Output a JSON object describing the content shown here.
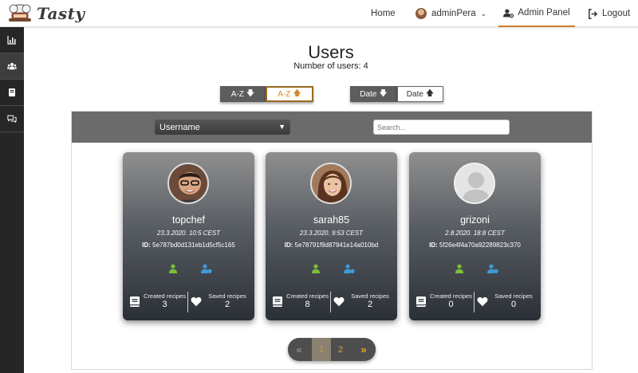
{
  "brand": {
    "name": "Tasty"
  },
  "nav": {
    "home": "Home",
    "user": "adminPera",
    "admin_panel": "Admin Panel",
    "logout": "Logout"
  },
  "sidebar": {
    "items": [
      {
        "icon": "bar-chart-icon"
      },
      {
        "icon": "users-icon",
        "active": true
      },
      {
        "icon": "book-icon"
      },
      {
        "icon": "comments-icon"
      }
    ]
  },
  "page": {
    "title": "Users",
    "count_text": "Number of users: 4"
  },
  "sort": {
    "az_down": "A-Z",
    "az_up": "A-Z",
    "date_down": "Date",
    "date_up": "Date",
    "active_color": "#d08a2a"
  },
  "filter": {
    "select_value": "Username",
    "search_placeholder": "Search..."
  },
  "users": [
    {
      "username": "topchef",
      "date": "23.3.2020. 10:5 CEST",
      "id_label": "ID:",
      "id": "5e787bd0d131eb1d5cf5c165",
      "created_label": "Created recipes",
      "created": "3",
      "saved_label": "Saved recipes",
      "saved": "2"
    },
    {
      "username": "sarah85",
      "date": "23.3.2020. 9:53 CEST",
      "id_label": "ID:",
      "id": "5e78791f9d87941e14a010bd",
      "created_label": "Created recipes",
      "created": "8",
      "saved_label": "Saved recipes",
      "saved": "2"
    },
    {
      "username": "grizoni",
      "date": "2.8.2020. 18:8 CEST",
      "id_label": "ID:",
      "id": "5f26e4f4a70a92289823c370",
      "created_label": "Created recipes",
      "created": "0",
      "saved_label": "Saved recipes",
      "saved": "0"
    }
  ],
  "pagination": {
    "first": "«",
    "pages": [
      "1",
      "2"
    ],
    "current": "1",
    "last": "»"
  },
  "colors": {
    "accent": "#c97c2c",
    "user_role": "#7cc03a",
    "admin_role": "#3f9bd8",
    "sidebar": "#262626"
  }
}
